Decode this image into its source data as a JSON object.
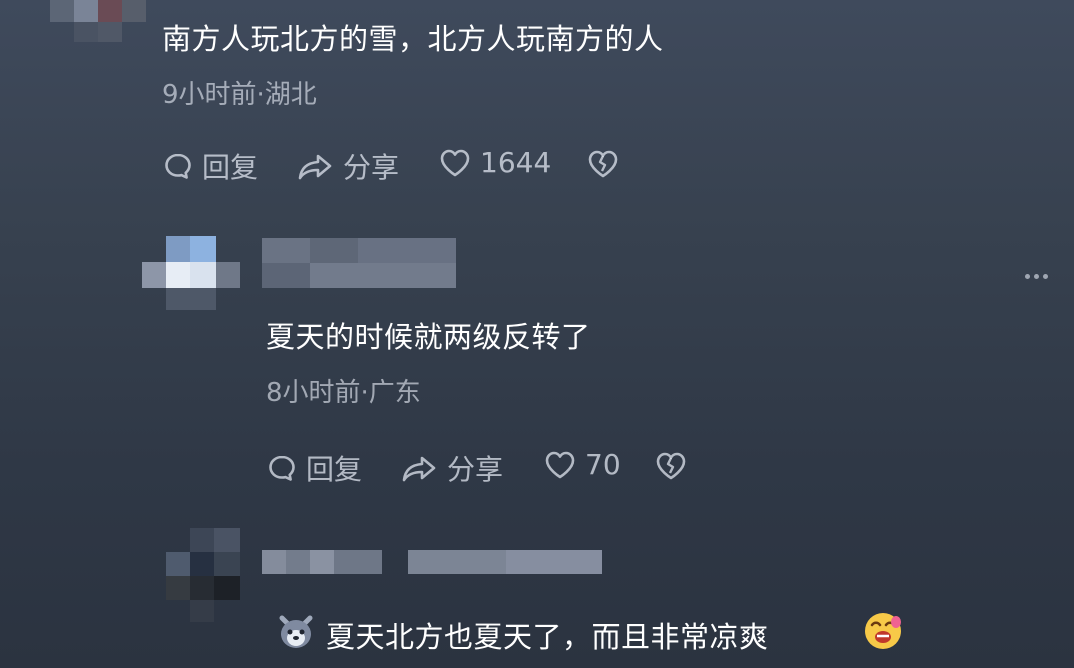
{
  "comment1": {
    "text": "南方人玩北方的雪，北方人玩南方的人",
    "meta": "9小时前·湖北",
    "actions": {
      "reply": "回复",
      "share": "分享",
      "likes": "1644"
    }
  },
  "reply1": {
    "text": "夏天的时候就两级反转了",
    "meta": "8小时前·广东",
    "actions": {
      "reply": "回复",
      "share": "分享",
      "likes": "70"
    }
  },
  "reply2": {
    "text": "夏天北方也夏天了，而且非常凉爽"
  },
  "icons": {
    "reply": "comment-bubble-icon",
    "share": "share-arrow-icon",
    "like": "heart-icon",
    "dislike": "broken-heart-icon",
    "more": "more-dots-icon"
  }
}
